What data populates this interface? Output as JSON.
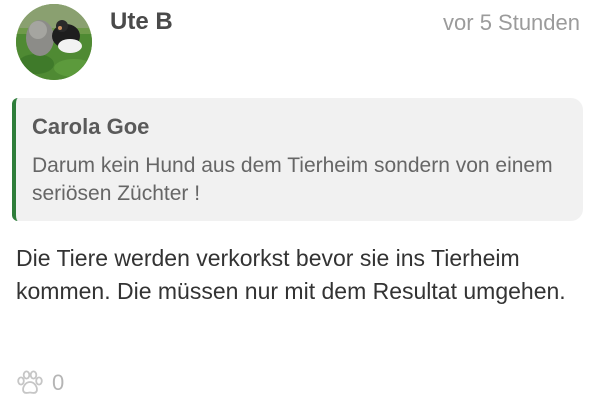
{
  "comment": {
    "author": "Ute B",
    "timestamp": "vor 5 Stunden",
    "avatar_icon": "dog-photo-avatar",
    "quote": {
      "author": "Carola Goe",
      "text": "Darum kein Hund aus dem Tierheim sondern von einem seriösen Züchter !",
      "accent_color": "#2e7d3a"
    },
    "body": "Die Tiere werden verkorkst bevor sie ins Tierheim kommen. Die müssen nur mit dem Resultat umgehen.",
    "reactions": {
      "icon": "paw-icon",
      "count": "0"
    }
  }
}
